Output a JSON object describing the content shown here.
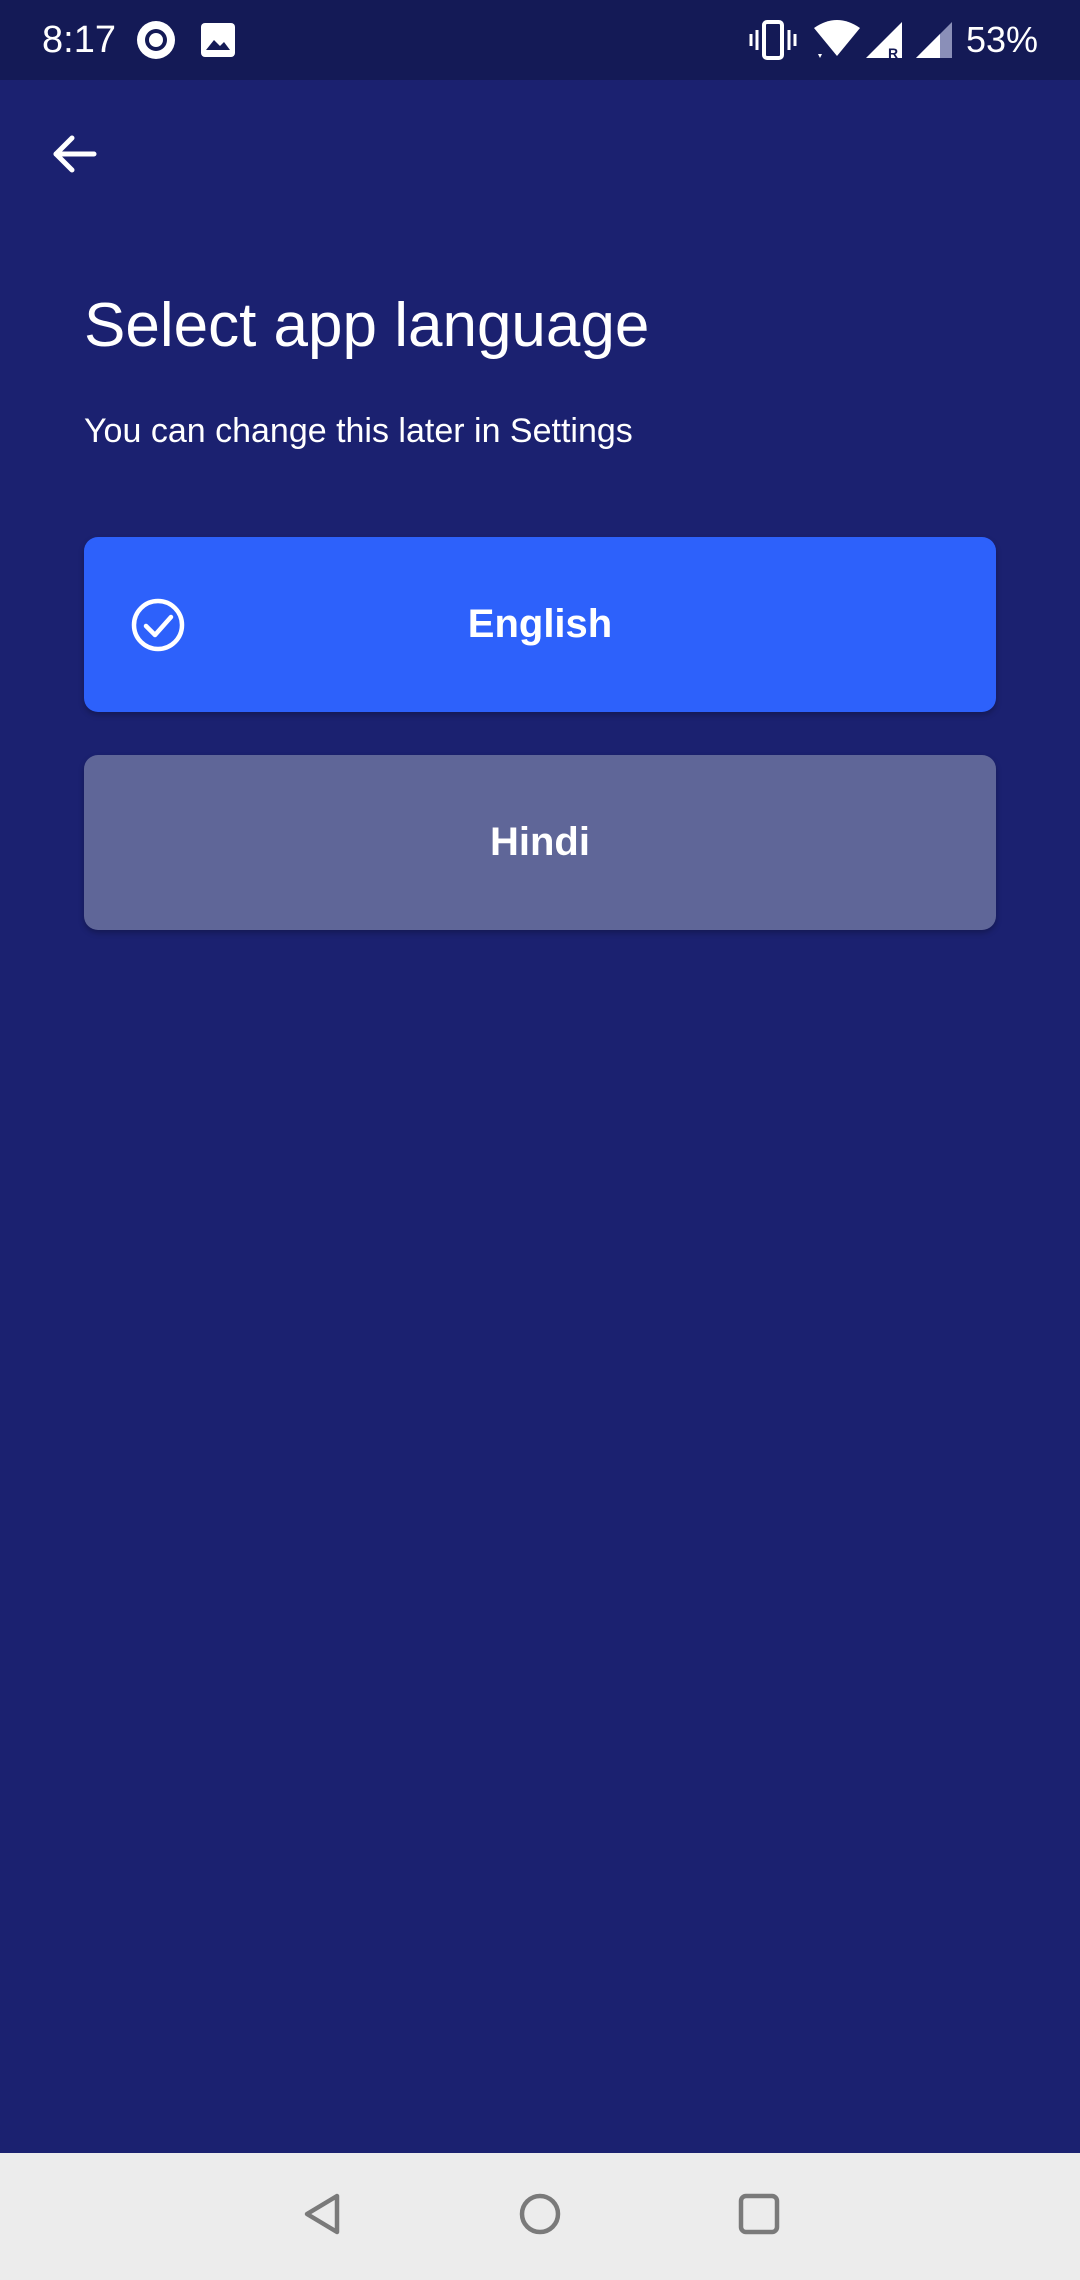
{
  "status_bar": {
    "time": "8:17",
    "battery": "53%",
    "icons": [
      "circle-app-icon",
      "image-icon",
      "vibrate-icon",
      "wifi-icon",
      "signal-roaming-icon",
      "signal-icon"
    ]
  },
  "header": {
    "back_icon": "arrow-left-icon",
    "title": "Select app language",
    "subtitle": "You can change this later in Settings"
  },
  "languages": [
    {
      "label": "English",
      "selected": true
    },
    {
      "label": "Hindi",
      "selected": false
    }
  ],
  "colors": {
    "background": "#1b2170",
    "status_bar": "#141a56",
    "selected": "#2d61fb",
    "unselected": "#5f6698",
    "nav_bar": "#ececec"
  },
  "nav_bar": {
    "icons": [
      "back-triangle-icon",
      "home-circle-icon",
      "recents-square-icon"
    ]
  }
}
